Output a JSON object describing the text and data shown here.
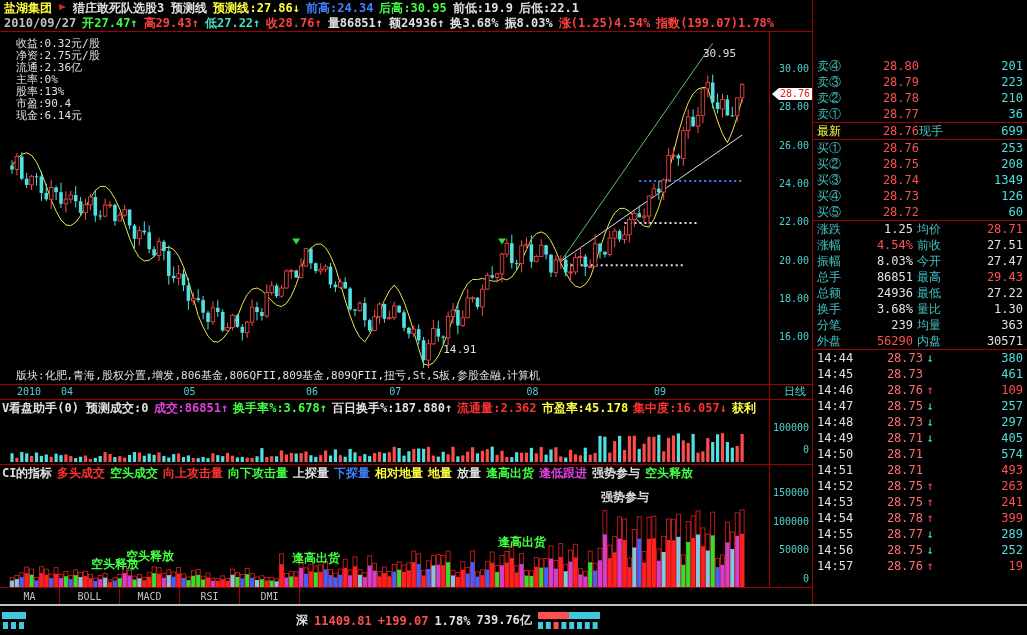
{
  "header": {
    "line1": [
      {
        "text": "盐湖集团",
        "color": "#ffff40"
      },
      {
        "text": "猎庄敢死队选股3 预测线",
        "color": "#e0e0e0"
      },
      {
        "text": "预测线:27.86↓",
        "color": "#ffff40"
      },
      {
        "text": "前高:24.34",
        "color": "#4080ff"
      },
      {
        "text": "后高:30.95",
        "color": "#40ff40"
      },
      {
        "text": "前低:19.9",
        "color": "#e0e0e0"
      },
      {
        "text": "后低:22.1",
        "color": "#e0e0e0"
      }
    ],
    "line2": [
      {
        "text": "2010/09/27",
        "color": "#c0c0c0"
      },
      {
        "text": "开27.47↑",
        "color": "#40ff40"
      },
      {
        "text": "高29.43↑",
        "color": "#ff4040"
      },
      {
        "text": "低27.22↑",
        "color": "#40e0c0"
      },
      {
        "text": "收28.76↑",
        "color": "#ff4040"
      },
      {
        "text": "量86851↑",
        "color": "#e0e0e0"
      },
      {
        "text": "额24936↑",
        "color": "#e0e0e0"
      },
      {
        "text": "换3.68%",
        "color": "#e0e0e0"
      },
      {
        "text": "振8.03%",
        "color": "#e0e0e0"
      },
      {
        "text": "涨(1.25)4.54%",
        "color": "#ff4040"
      },
      {
        "text": "指数(199.07)1.78%",
        "color": "#ff4040"
      }
    ]
  },
  "info": [
    "收益:0.32元/股",
    "净资:2.75元/股",
    "流通:2.36亿",
    "主率:0%",
    "股率:13%",
    "市盈:90.4",
    "现金:6.14元"
  ],
  "price_chart": {
    "axis": [
      "30.00",
      "28.00",
      "26.00",
      "24.00",
      "22.00",
      "20.00",
      "18.00",
      "16.00"
    ],
    "current": "28.76",
    "high_label": "30.95",
    "low_label": "14.91"
  },
  "sector": "版块:化肥,青海,股权分置,增发,806基金,806QFII,809基金,809QFII,扭亏,St,S板,参股金融,计算机",
  "dates": [
    "2010",
    "04",
    "05",
    "06",
    "07",
    "08",
    "09"
  ],
  "period": "日线",
  "volume_panel": {
    "legend": [
      {
        "text": "V看盘助手(0) 预测成交:0",
        "color": "#e0e0e0"
      },
      {
        "text": "成交:86851↑",
        "color": "#e040e0"
      },
      {
        "text": "换手率%:3.678↑",
        "color": "#40ff40"
      },
      {
        "text": "百日换手%:187.880↑",
        "color": "#e0e0e0"
      },
      {
        "text": "流通量:2.362",
        "color": "#ff3030"
      },
      {
        "text": "市盈率:45.178",
        "color": "#ffff40"
      },
      {
        "text": "集中度:16.057↓",
        "color": "#ff3030"
      },
      {
        "text": "获利",
        "color": "#ffff40"
      }
    ],
    "axis": [
      "100000",
      "0"
    ]
  },
  "ci_panel": {
    "legend": [
      {
        "text": "CI的指标",
        "color": "#e0e0e0"
      },
      {
        "text": "多头成交",
        "color": "#ff3030"
      },
      {
        "text": "空头成交",
        "color": "#40ff40"
      },
      {
        "text": "向上攻击量",
        "color": "#ff3030"
      },
      {
        "text": "向下攻击量",
        "color": "#40ff40"
      },
      {
        "text": "上探量",
        "color": "#e0e0e0"
      },
      {
        "text": "下探量",
        "color": "#4080ff"
      },
      {
        "text": "相对地量",
        "color": "#ffff40"
      },
      {
        "text": "地量",
        "color": "#ffff40"
      },
      {
        "text": "放量",
        "color": "#e0e0e0"
      },
      {
        "text": "逢高出货",
        "color": "#40ff40"
      },
      {
        "text": "逢低跟进",
        "color": "#e040e0"
      },
      {
        "text": "强势参与",
        "color": "#e0e0e0"
      },
      {
        "text": "空头释放",
        "color": "#40ff40"
      }
    ],
    "axis": [
      "150000",
      "100000",
      "50000",
      "0"
    ],
    "labels": [
      {
        "text": "空头释放",
        "color": "#40ff40"
      },
      {
        "text": "空头释放",
        "color": "#40ff40"
      },
      {
        "text": "逢高出货",
        "color": "#40ff40"
      },
      {
        "text": "逢高出货",
        "color": "#40ff40"
      },
      {
        "text": "强势参与",
        "color": "#e0e0e0"
      }
    ]
  },
  "tabs": [
    {
      "label": "MA",
      "selected": false
    },
    {
      "label": "BOLL",
      "selected": false
    },
    {
      "label": "MACD",
      "selected": false
    },
    {
      "label": "RSI",
      "selected": false
    },
    {
      "label": "DMI",
      "selected": false
    }
  ],
  "order_book": {
    "asks": [
      {
        "label": "卖④",
        "price": "28.80",
        "volume": "201"
      },
      {
        "label": "卖③",
        "price": "28.79",
        "volume": "223"
      },
      {
        "label": "卖②",
        "price": "28.78",
        "volume": "210"
      },
      {
        "label": "卖①",
        "price": "28.77",
        "volume": "36"
      }
    ],
    "last": {
      "label": "最新",
      "price": "28.76",
      "label2": "现手",
      "volume": "699"
    },
    "bids": [
      {
        "label": "买①",
        "price": "28.76",
        "volume": "253"
      },
      {
        "label": "买②",
        "price": "28.75",
        "volume": "208"
      },
      {
        "label": "买③",
        "price": "28.74",
        "volume": "1349"
      },
      {
        "label": "买④",
        "price": "28.73",
        "volume": "126"
      },
      {
        "label": "买⑤",
        "price": "28.72",
        "volume": "60"
      }
    ]
  },
  "stats": [
    {
      "label": "涨跌",
      "value": "1.25",
      "color": "#e0e0e0"
    },
    {
      "label": "均价",
      "value": "28.71",
      "color": "#ff5050"
    },
    {
      "label": "涨幅",
      "value": "4.54%",
      "color": "#ff5050"
    },
    {
      "label": "前收",
      "value": "27.51",
      "color": "#e0e0e0"
    },
    {
      "label": "振幅",
      "value": "8.03%",
      "color": "#e0e0e0"
    },
    {
      "label": "今开",
      "value": "27.47",
      "color": "#e0e0e0"
    },
    {
      "label": "总手",
      "value": "86851",
      "color": "#e0e0e0"
    },
    {
      "label": "最高",
      "value": "29.43",
      "color": "#ff5050"
    },
    {
      "label": "总额",
      "value": "24936",
      "color": "#e0e0e0"
    },
    {
      "label": "最低",
      "value": "27.22",
      "color": "#e0e0e0"
    },
    {
      "label": "换手",
      "value": "3.68%",
      "color": "#e0e0e0"
    },
    {
      "label": "量比",
      "value": "1.30",
      "color": "#e0e0e0"
    },
    {
      "label": "分笔",
      "value": "239",
      "color": "#e0e0e0"
    },
    {
      "label": "均量",
      "value": "363",
      "color": "#e0e0e0"
    },
    {
      "label": "外盘",
      "value": "56290",
      "color": "#ff5050"
    },
    {
      "label": "内盘",
      "value": "30571",
      "color": "#e0e0e0"
    }
  ],
  "ticks": [
    {
      "time": "14:44",
      "price": "28.73",
      "arrow": "↓",
      "volume": "380",
      "color": "#50e0e0"
    },
    {
      "time": "14:45",
      "price": "28.73",
      "volume": "461",
      "color": "#50e0e0"
    },
    {
      "time": "14:46",
      "price": "28.76",
      "arrow": "↑",
      "volume": "109",
      "color": "#ff5050"
    },
    {
      "time": "14:47",
      "price": "28.75",
      "arrow": "↓",
      "volume": "257",
      "color": "#50e0e0"
    },
    {
      "time": "14:48",
      "price": "28.73",
      "arrow": "↓",
      "volume": "297",
      "color": "#50e0e0"
    },
    {
      "time": "14:49",
      "price": "28.71",
      "arrow": "↓",
      "volume": "405",
      "color": "#50e0e0"
    },
    {
      "time": "14:50",
      "price": "28.71",
      "volume": "574",
      "color": "#50e0e0"
    },
    {
      "time": "14:51",
      "price": "28.71",
      "volume": "493",
      "color": "#ff5050"
    },
    {
      "time": "14:52",
      "price": "28.75",
      "arrow": "↑",
      "volume": "263",
      "color": "#ff5050"
    },
    {
      "time": "14:53",
      "price": "28.75",
      "arrow": "↑",
      "volume": "241",
      "color": "#ff5050"
    },
    {
      "time": "14:54",
      "price": "28.78",
      "arrow": "↑",
      "volume": "399",
      "color": "#ff5050"
    },
    {
      "time": "14:55",
      "price": "28.77",
      "arrow": "↓",
      "volume": "289",
      "color": "#50e0e0"
    },
    {
      "time": "14:56",
      "price": "28.75",
      "arrow": "↓",
      "volume": "252",
      "color": "#50e0e0"
    },
    {
      "time": "14:57",
      "price": "28.76",
      "arrow": "↑",
      "volume": "19",
      "color": "#ff5050"
    }
  ],
  "status_bar": [
    {
      "text": "深",
      "color": "#e0e0e0"
    },
    {
      "text": "11409.81",
      "color": "#ff5050"
    },
    {
      "text": "+199.07",
      "color": "#ff5050"
    },
    {
      "text": "1.78%",
      "color": "#e0e0e0"
    },
    {
      "text": "739.76亿",
      "color": "#e0e0e0"
    }
  ]
}
